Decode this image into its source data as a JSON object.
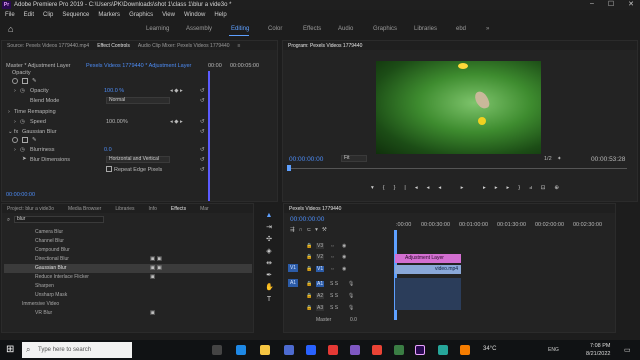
{
  "window": {
    "title": "Adobe Premiere Pro 2019 - C:\\Users\\PK\\Downloads\\shot 1\\class 1\\blur a vide3o *"
  },
  "menu": [
    "File",
    "Edit",
    "Clip",
    "Sequence",
    "Markers",
    "Graphics",
    "View",
    "Window",
    "Help"
  ],
  "workspaces": [
    "Learning",
    "Assembly",
    "Editing",
    "Color",
    "Effects",
    "Audio",
    "Graphics",
    "Libraries",
    "ebd"
  ],
  "workspace_active": "Editing",
  "effect_controls": {
    "tabs": [
      "Source: Pexels Videos 1779440.mp4",
      "Effect Controls",
      "Audio Clip Mixer: Pexels Videos 1779440"
    ],
    "tab_menu": "≡",
    "master": "Master * Adjustment Layer",
    "clip": "Pexels Videos 1779440 * Adjustment Layer",
    "ruler_time": "00:00",
    "ruler_time2": "00:00:05:00",
    "opacity_section": "Opacity",
    "opacity_label": "Opacity",
    "opacity_value": "100.0 %",
    "blend_label": "Blend Mode",
    "blend_value": "Normal",
    "time_remap": "Time Remapping",
    "speed_label": "Speed",
    "speed_value": "100.00%",
    "blur_section": "Gaussian Blur",
    "blurriness_label": "Blurriness",
    "blurriness_value": "0.0",
    "dimensions_label": "Blur Dimensions",
    "dimensions_value": "Horizontal and Vertical",
    "repeat_label": "Repeat Edge Pixels",
    "timecode": "00:00:00:00"
  },
  "program": {
    "title": "Program: Pexels Videos 1779440",
    "timecode": "00:00:00:00",
    "fit": "Fit",
    "fraction": "1/2",
    "duration": "00:00:53:28"
  },
  "project": {
    "tabs": [
      "Project: blur a vide3o",
      "Media Browser",
      "Libraries",
      "Info",
      "Effects",
      "Mar"
    ],
    "active_tab": "Effects",
    "search_value": "blur",
    "items": [
      "Camera Blur",
      "Channel Blur",
      "Compound Blur",
      "Directional Blur",
      "Gaussian Blur",
      "Reduce Interlace Flicker",
      "Sharpen",
      "Unsharp Mask",
      "Immersive Video",
      "VR Blur"
    ]
  },
  "timeline": {
    "title": "Pexels Videos 1779440",
    "timecode": "00:00:00:00",
    "ruler": [
      ":00:00",
      "00:00:30:00",
      "00:01:00:00",
      "00:01:30:00",
      "00:02:00:00",
      "00:02:30:00"
    ],
    "video_tracks": [
      "V3",
      "V2",
      "V1"
    ],
    "audio_tracks": [
      "A1",
      "A2",
      "A3"
    ],
    "src_v": "V1",
    "src_a": "A1",
    "master": "Master",
    "master_val": "0.0",
    "clip_adj": "Adjustment Layer",
    "clip_vid": "video.mp4",
    "db": "S S"
  },
  "taskbar": {
    "search_placeholder": "Type here to search",
    "weather": "34°C",
    "lang": "ENG",
    "time": "7:08 PM",
    "date": "8/21/2022"
  }
}
